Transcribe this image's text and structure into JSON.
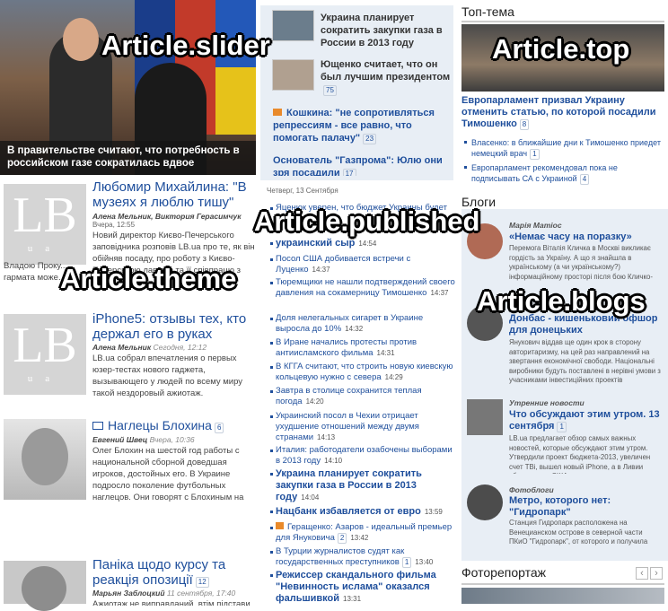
{
  "annotations": {
    "slider": "Article.slider",
    "top": "Article.top",
    "published": "Article.published",
    "theme": "Article.theme",
    "blogs": "Article.blogs"
  },
  "slider": {
    "caption": "В правительстве считают, что потребность в российском газе сократилась вдвое"
  },
  "middle_top": {
    "items": [
      {
        "title": "Украина планирует сократить закупки газа в России в 2013 году"
      },
      {
        "title": "Ющенко считает, что он был лучшим президентом",
        "count": "75"
      },
      {
        "title": "Кошкина: \"не сопротивляться репрессиям - все равно, что помогать палачу\"",
        "count": "23"
      },
      {
        "title": "Основатель \"Газпрома\": Юлю они зря посадили",
        "count": "17"
      }
    ]
  },
  "left": {
    "items": [
      {
        "title": "Любомир Михайлина: \"В музеях я люблю тишу\"",
        "author": "Алена Мельник, Виктория Герасимчук",
        "date": "Вчера, 12:55",
        "text": "Новий директор Києво-Печерського заповідника розповів LB.ua про те, як він обійняв посаду, про роботу з Києво-Печерською лаврою та її співпрацю з",
        "text2": "Владою Проку... гармата може..."
      },
      {
        "title": "iPhone5: отзывы тех, кто держал его в руках",
        "author": "Алена Мельник",
        "date": "Сегодня, 12:12",
        "text": "LB.ua собрал впечатления о первых юзер-тестах нового гаджета, вызывающего у людей по всему миру такой нездоровый ажиотаж."
      },
      {
        "title": "Наглецы Блохина",
        "count": "6",
        "author": "Евгений Швец",
        "date": "Вчера, 10:36",
        "text": "Олег Блохин на шестой год работы с национальной сборной доведшая игроков, достойных его. В Украине подросло поколение футбольных наглецов. Они говорят с Блохиным на одном языке. Они с ним одной крови. Гремучая смесь почти дала результат на «Уэмбли». Если бы еще сам наставник не «уснул» на посту..."
      },
      {
        "title": "Паніка щодо курсу та реакція опозиції",
        "count": "12",
        "author": "Марьян Заблоцкий",
        "date": "11 сентября, 17:40",
        "text": "Ажиотаж не виправданий, втім підстави таки"
      }
    ]
  },
  "published": {
    "date": "Четверг, 13 Сентября",
    "items": [
      {
        "title": "Яценюк уверен, что бюджет Украины будет ...",
        "time": ""
      },
      {
        "title": "украинский сыр",
        "time": "14:54",
        "bold": true
      },
      {
        "title": "Россия ... украинский сыр",
        "time": "14:54"
      },
      {
        "title": "Посол США добивается встречи с Луценко",
        "time": "14:37"
      },
      {
        "title": "Тюремщики не нашли подтверждений своего давления на сокамерницу Тимошенко",
        "time": "14:37"
      },
      {
        "title": "Доля нелегальных сигарет в Украине выросла до 10%",
        "time": "14:32"
      },
      {
        "title": "В Иране начались протесты против антиисламского фильма",
        "time": "14:31"
      },
      {
        "title": "В КГГА считают, что строить новую киевскую кольцевую нужно с севера",
        "time": "14:29"
      },
      {
        "title": "Завтра в столице сохранится теплая погода",
        "time": "14:20"
      },
      {
        "title": "Украинский посол в Чехии отрицает ухудшение отношений между двумя странами",
        "time": "14:13"
      },
      {
        "title": "Италия: работодатели озабочены выборами в 2013 году",
        "time": "14:10"
      },
      {
        "title": "Украина планирует сократить закупки газа в России в 2013 году",
        "time": "14:04",
        "bold": true
      },
      {
        "title": "Нацбанк избавляется от евро",
        "time": "13:59",
        "bold": true
      },
      {
        "title": "Геращенко: Азаров - идеальный премьер для Януковича",
        "count": "2",
        "time": "13:42"
      },
      {
        "title": "В Турции журналистов судят как государственных преступников",
        "count": "1",
        "time": "13:40"
      },
      {
        "title": "Режиссер скандального фильма \"Невинность ислама\" оказался фальшивкой",
        "time": "13:31",
        "bold": true
      }
    ]
  },
  "top": {
    "heading": "Топ-тема",
    "main": "Европарламент призвал Украину отменить статью, по которой посадили Тимошенко",
    "main_count": "8",
    "subs": [
      {
        "title": "Власенко: в ближайшие дни к Тимошенко приедет немецкий врач",
        "count": "1"
      },
      {
        "title": "Европарламент рекомендовал пока не подписывать СА с Украиной",
        "count": "4"
      }
    ]
  },
  "blogs": {
    "heading": "Блоги",
    "items": [
      {
        "author": "Марія Матіос",
        "title": "«Немає часу на поразку»",
        "text": "Перемога Віталія Кличка в Москві викликає гордість за Україну. А що я знайшла в українському (а чи українському?) інформаційному просторі після бою Кличко-Чарр? Пафосний текст..."
      },
      {
        "author": "",
        "title": "Донбас - кишеньковий офшор для донецьких",
        "text": "Янукович віддав ще один крок в сторону авторитаризму, на цей раз направлений на звертання економічної свободи. Національні виробники будуть поставлені в нерівні умови з учасниками інвестиційних проектів"
      },
      {
        "author": "Утренние новости",
        "title": "Что обсуждают этим утром. 13 сентября",
        "count": "1",
        "text": "LB.ua предлагает обзор самых важных новостей, которые обсуждают этим утром. Утвердили проект бюджета-2013, увеличен счет ТВі, вышел новый iPhone, а в Ливии убили посла США."
      },
      {
        "author": "Фотоблоги",
        "title": "Метро, которого нет: \"Гидропарк\"",
        "text": "Станция Гидропарк расположена на Венецианском острове в северной части ПКиО \"Гидропарк\", от которого и получила свое название."
      }
    ]
  },
  "photoreport": {
    "heading": "Фоторепортаж",
    "prev": "‹",
    "next": "›"
  }
}
